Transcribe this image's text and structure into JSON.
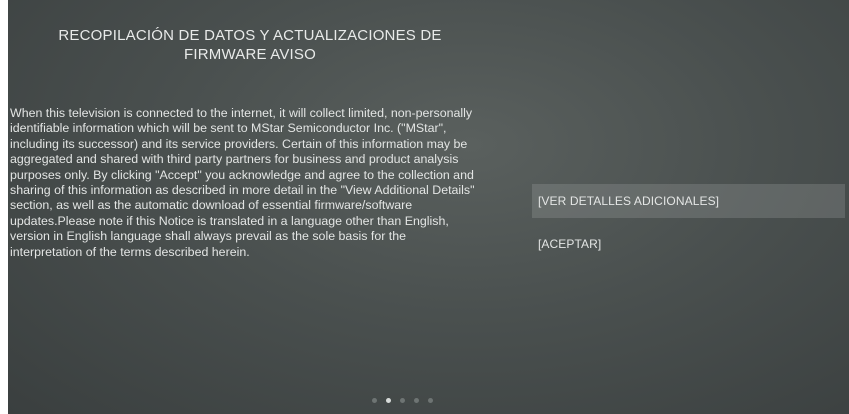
{
  "dialog": {
    "title": "RECOPILACIÓN DE DATOS Y ACTUALIZACIONES DE FIRMWARE AVISO",
    "body": "When this television is connected to the internet, it will collect limited, non-personally identifiable information which will be sent to MStar Semiconductor Inc. (\"MStar\", including its successor) and its service providers. Certain of this information may be aggregated and shared with third party partners for business and product analysis purposes only. By clicking \"Accept\" you acknowledge and agree to the collection and sharing of this information as described in more detail in the \"View Additional Details\" section, as well as the automatic download of essential firmware/software updates.Please note if this Notice is translated in a language other than English, version in English language shall always prevail as the sole basis for the interpretation of the terms described herein."
  },
  "menu": {
    "items": [
      {
        "label": "[VER DETALLES ADICIONALES]",
        "selected": true
      },
      {
        "label": "[ACEPTAR]",
        "selected": false
      }
    ]
  },
  "pager": {
    "total": 5,
    "current": 2
  }
}
